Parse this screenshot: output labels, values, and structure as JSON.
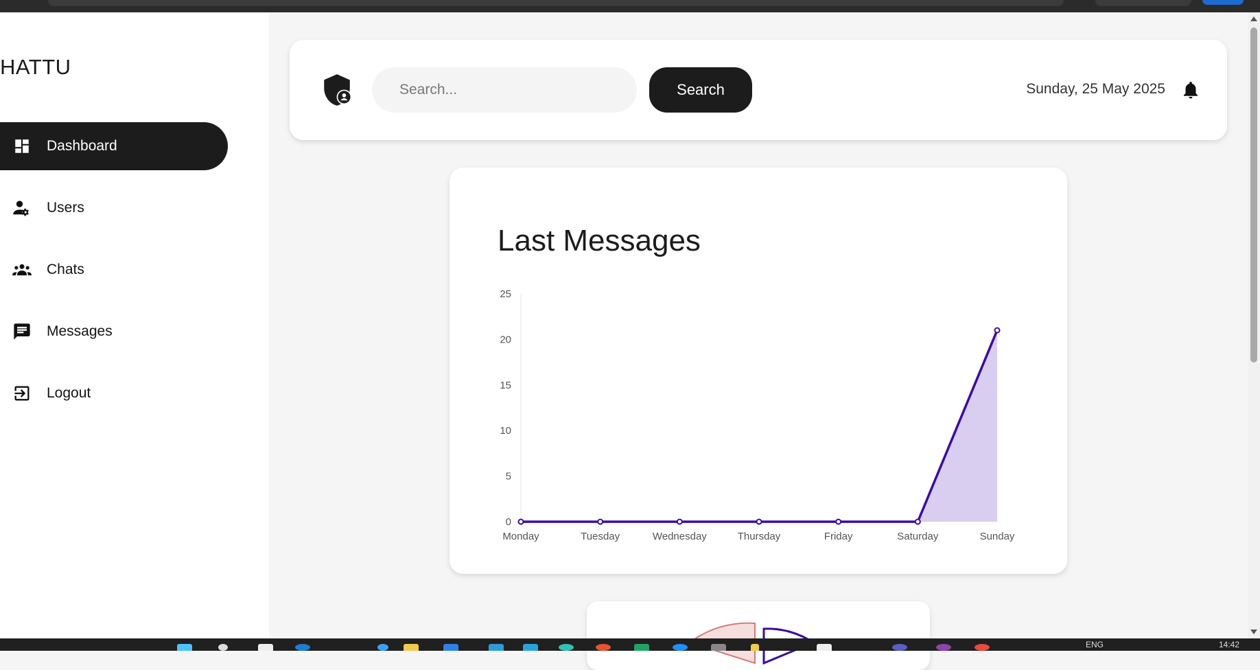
{
  "app": {
    "brand": "HATTU"
  },
  "sidebar": {
    "items": [
      {
        "label": "Dashboard",
        "icon": "dashboard-icon",
        "active": true
      },
      {
        "label": "Users",
        "icon": "user-gear-icon",
        "active": false
      },
      {
        "label": "Chats",
        "icon": "group-icon",
        "active": false
      },
      {
        "label": "Messages",
        "icon": "message-icon",
        "active": false
      },
      {
        "label": "Logout",
        "icon": "logout-icon",
        "active": false
      }
    ]
  },
  "header": {
    "search_placeholder": "Search...",
    "search_value": "",
    "search_button": "Search",
    "date": "Sunday, 25 May 2025"
  },
  "colors": {
    "accent": "#1c1c1c",
    "line": "#3a0ca3",
    "area": "#d9cdf0"
  },
  "chart_data": {
    "type": "area",
    "title": "Last Messages",
    "categories": [
      "Monday",
      "Tuesday",
      "Wednesday",
      "Thursday",
      "Friday",
      "Saturday",
      "Sunday"
    ],
    "values": [
      0,
      0,
      0,
      0,
      0,
      0,
      21
    ],
    "ylim": [
      0,
      25
    ],
    "yticks": [
      0,
      5,
      10,
      15,
      20,
      25
    ],
    "xlabel": "",
    "ylabel": "",
    "grid": false
  },
  "taskbar": {
    "lang": "ENG",
    "time": "14:42"
  }
}
